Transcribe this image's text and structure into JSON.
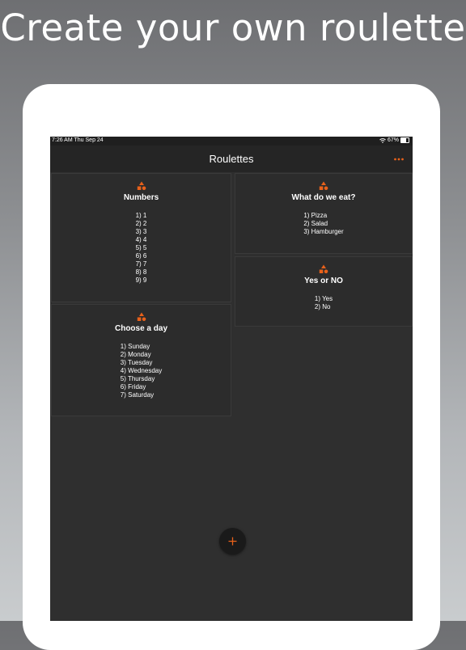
{
  "headline": "Create your own roulette",
  "status_bar": {
    "time": "7:26 AM  Thu Sep 24",
    "battery": "67%",
    "battery_level": 0.67
  },
  "nav": {
    "title": "Roulettes",
    "more_icon": "ellipsis-icon"
  },
  "accent_color": "#e8611a",
  "cards": [
    {
      "title": "Numbers",
      "items": [
        "1) 1",
        "2) 2",
        "3) 3",
        "4) 4",
        "5) 5",
        "6) 6",
        "7) 7",
        "8) 8",
        "9) 9"
      ]
    },
    {
      "title": "What do we eat?",
      "items": [
        "1) Pizza",
        "2) Salad",
        "3) Hamburger"
      ]
    },
    {
      "title": "Yes or NO",
      "items": [
        "1) Yes",
        "2) No"
      ]
    },
    {
      "title": "Choose a day",
      "items": [
        "1) Sunday",
        "2) Monday",
        "3) Tuesday",
        "4) Wednesday",
        "5) Thursday",
        "6) Friday",
        "7) Saturday"
      ]
    }
  ],
  "fab_icon": "plus-icon"
}
